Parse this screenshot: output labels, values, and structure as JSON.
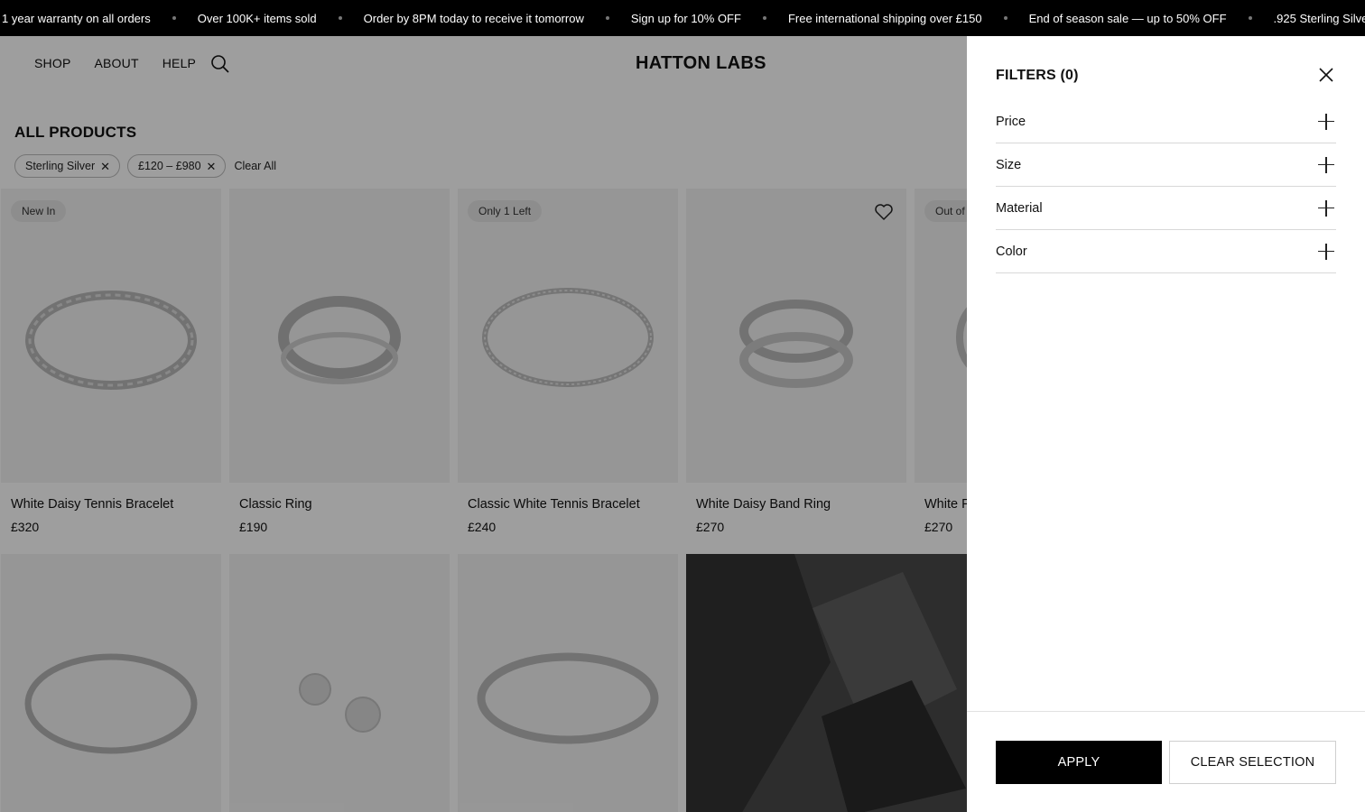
{
  "announcement": {
    "items": [
      "1 year warranty on all orders",
      "Over 100K+ items sold",
      "Order by 8PM today to receive it tomorrow",
      "Sign up for 10% OFF",
      "Free international shipping over £150",
      "End of season sale — up to 50% OFF",
      ".925 Sterling Silver"
    ]
  },
  "nav": {
    "links": [
      "SHOP",
      "ABOUT",
      "HELP"
    ],
    "search_icon": "search-icon",
    "logo": "HATTON LABS"
  },
  "listing": {
    "heading": "ALL PRODUCTS",
    "active_filters": [
      "Sterling Silver",
      "£120 – £980"
    ],
    "clear_all": "Clear All"
  },
  "products": [
    {
      "name": "White Daisy Tennis Bracelet",
      "price": "£320",
      "badge": "New In"
    },
    {
      "name": "Classic Ring",
      "price": "£190",
      "badge": ""
    },
    {
      "name": "Classic White Tennis Bracelet",
      "price": "£240",
      "badge": "Only 1 Left"
    },
    {
      "name": "White Daisy Band Ring",
      "price": "£270",
      "badge": ""
    },
    {
      "name": "White F",
      "price": "£270",
      "badge": "Out of"
    }
  ],
  "drawer": {
    "title": "FILTERS (0)",
    "sections": [
      "Price",
      "Size",
      "Material",
      "Color"
    ],
    "apply": "APPLY",
    "clear": "CLEAR SELECTION"
  },
  "colors": {
    "announcement_bg": "#000000",
    "apply_bg": "#000000",
    "overlay": "rgba(0,0,0,0.38)"
  }
}
